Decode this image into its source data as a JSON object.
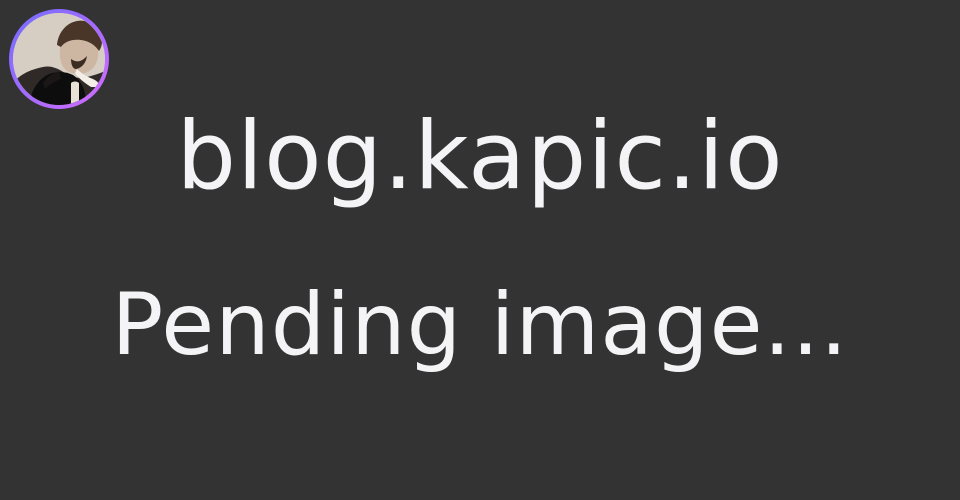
{
  "site": {
    "title": "blog.kapic.io",
    "status": "Pending image..."
  },
  "avatar": {
    "icon": "profile-photo",
    "ring_gradient": [
      "#6f6cff",
      "#a36bff",
      "#d66bff"
    ]
  },
  "colors": {
    "background": "#333333",
    "text": "#f4f4f6"
  }
}
